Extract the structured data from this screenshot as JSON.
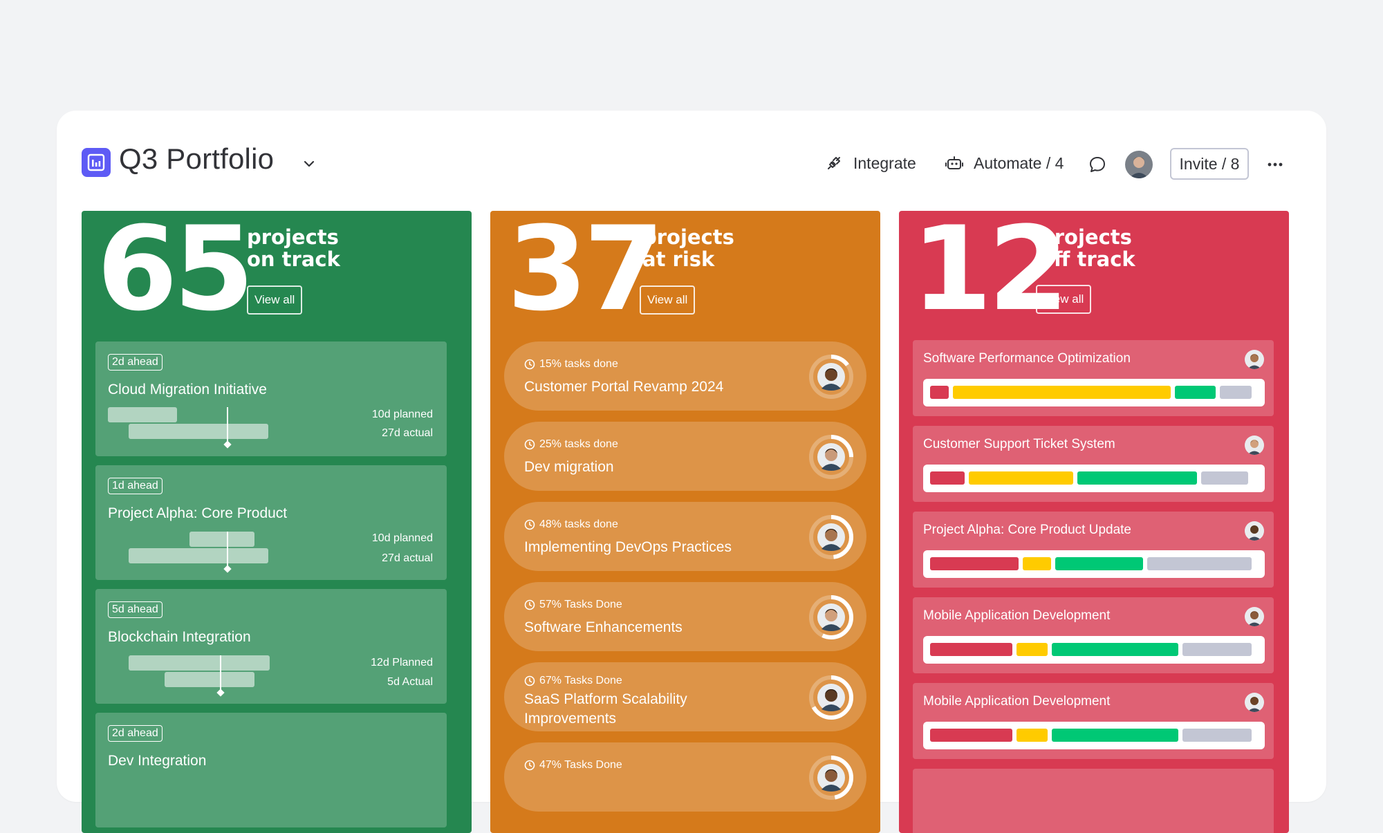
{
  "header": {
    "title": "Q3 Portfolio",
    "integrate_label": "Integrate",
    "automate_label": "Automate / 4",
    "invite_label": "Invite / 8"
  },
  "columns": {
    "on_track": {
      "count": "65",
      "line1": "projects",
      "line2": "on track",
      "view_all": "View all",
      "color": "#258750",
      "cards": [
        {
          "badge": "2d ahead",
          "name": "Cloud Migration Initiative",
          "planned": "10d planned",
          "actual": "27d actual"
        },
        {
          "badge": "1d ahead",
          "name": "Project Alpha: Core Product",
          "planned": "10d planned",
          "actual": "27d actual"
        },
        {
          "badge": "5d ahead",
          "name": "Blockchain Integration",
          "planned": "12d Planned",
          "actual": "5d Actual"
        },
        {
          "badge": "2d ahead",
          "name": "Dev Integration",
          "planned": "",
          "actual": ""
        }
      ]
    },
    "at_risk": {
      "count": "37",
      "line1": "projects",
      "line2": "at risk",
      "view_all": "View all",
      "color": "#d57a1b",
      "cards": [
        {
          "meta": "15% tasks done",
          "name": "Customer Portal Revamp 2024",
          "progress": 0.15
        },
        {
          "meta": "25% tasks done",
          "name": "Dev migration",
          "progress": 0.25
        },
        {
          "meta": "48% tasks done",
          "name": "Implementing DevOps Practices",
          "progress": 0.48
        },
        {
          "meta": "57% Tasks Done",
          "name": "Software Enhancements",
          "progress": 0.57
        },
        {
          "meta": "67% Tasks Done",
          "name_line1": "SaaS Platform Scalability",
          "name_line2": "Improvements",
          "progress": 0.67
        },
        {
          "meta": "47% Tasks Done",
          "name": "",
          "progress": 0.47
        }
      ]
    },
    "off_track": {
      "count": "12",
      "line1": "projects",
      "line2": "off track",
      "view_all": "View all",
      "color": "#d83a52",
      "cards": [
        {
          "name": "Software Performance Optimization",
          "segments": [
            {
              "color": "#d83a52",
              "share": 0.06
            },
            {
              "color": "#ffcb00",
              "share": 0.69
            },
            {
              "color": "#00c875",
              "share": 0.13
            },
            {
              "color": "#c3c6d4",
              "share": 0.1
            }
          ]
        },
        {
          "name": "Customer Support Ticket System",
          "segments": [
            {
              "color": "#d83a52",
              "share": 0.11
            },
            {
              "color": "#ffcb00",
              "share": 0.33
            },
            {
              "color": "#00c875",
              "share": 0.38
            },
            {
              "color": "#c3c6d4",
              "share": 0.15
            }
          ]
        },
        {
          "name": "Project Alpha: Core Product Update",
          "segments": [
            {
              "color": "#d83a52",
              "share": 0.28
            },
            {
              "color": "#ffcb00",
              "share": 0.09
            },
            {
              "color": "#00c875",
              "share": 0.28
            },
            {
              "color": "#c3c6d4",
              "share": 0.33
            }
          ]
        },
        {
          "name": "Mobile Application Development",
          "segments": [
            {
              "color": "#d83a52",
              "share": 0.26
            },
            {
              "color": "#ffcb00",
              "share": 0.1
            },
            {
              "color": "#00c875",
              "share": 0.4
            },
            {
              "color": "#c3c6d4",
              "share": 0.22
            }
          ]
        },
        {
          "name": "Mobile Application Development",
          "segments": [
            {
              "color": "#d83a52",
              "share": 0.26
            },
            {
              "color": "#ffcb00",
              "share": 0.1
            },
            {
              "color": "#00c875",
              "share": 0.4
            },
            {
              "color": "#c3c6d4",
              "share": 0.22
            }
          ]
        }
      ]
    }
  },
  "colors": {
    "red": "#d83a52",
    "yellow": "#ffcb00",
    "green": "#00c875",
    "grey": "#c3c6d4"
  }
}
